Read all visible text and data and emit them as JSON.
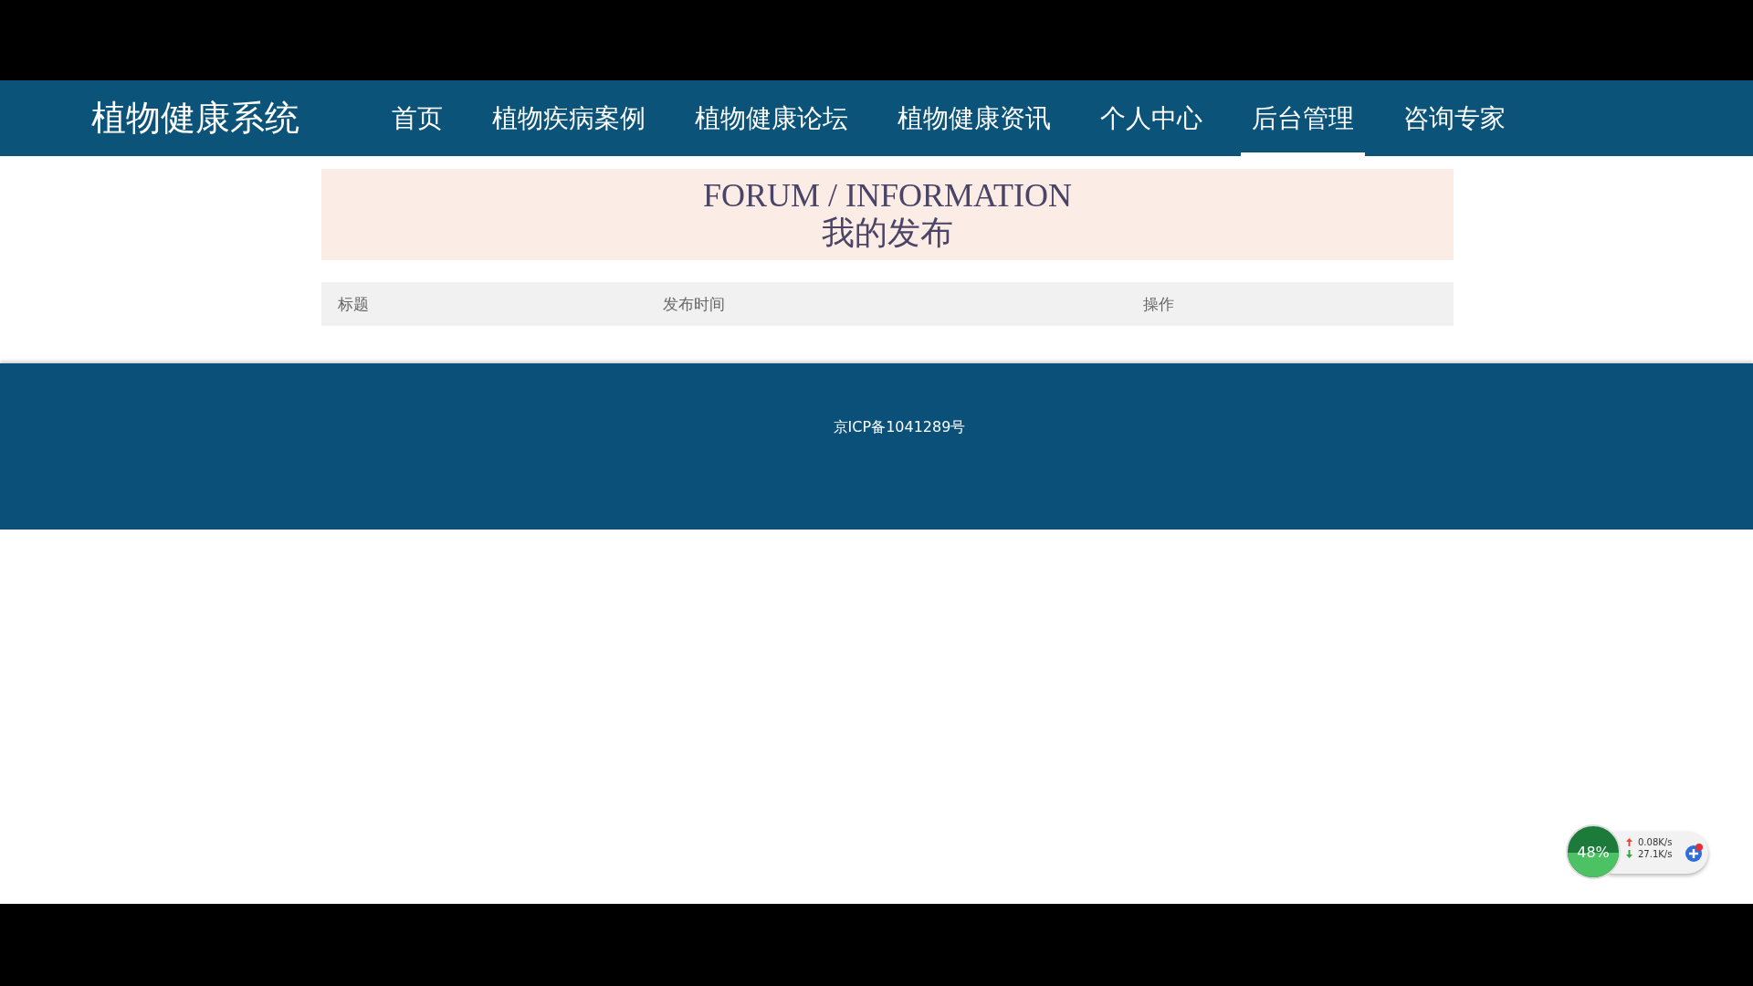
{
  "nav": {
    "logo": "植物健康系统",
    "items": [
      {
        "label": "首页",
        "selected": false
      },
      {
        "label": "植物疾病案例",
        "selected": false
      },
      {
        "label": "植物健康论坛",
        "selected": false
      },
      {
        "label": "植物健康资讯",
        "selected": false
      },
      {
        "label": "个人中心",
        "selected": false
      },
      {
        "label": "后台管理",
        "selected": true
      },
      {
        "label": "咨询专家",
        "selected": false
      }
    ]
  },
  "banner": {
    "title": "FORUM / INFORMATION",
    "subtitle": "我的发布"
  },
  "table": {
    "columns": [
      "标题",
      "发布时间",
      "操作"
    ]
  },
  "footer": {
    "text": "京ICP备1041289号"
  },
  "net_widget": {
    "percent": "48%",
    "upload": "0.08K/s",
    "download": "27.1K/s"
  }
}
